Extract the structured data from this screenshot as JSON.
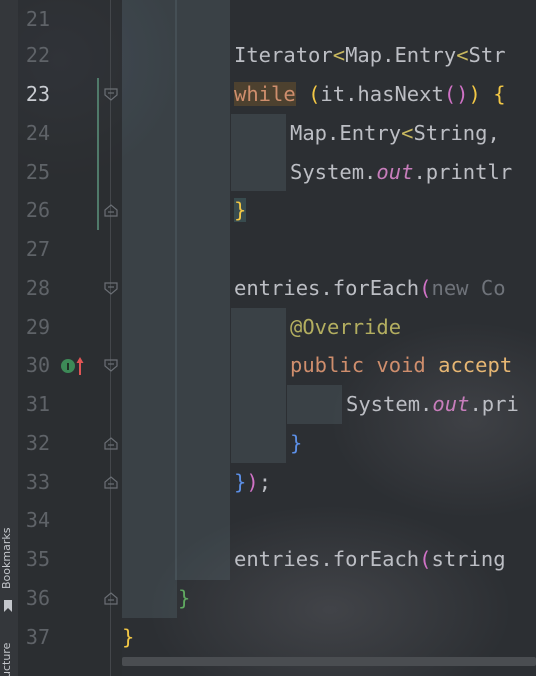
{
  "side_panel": {
    "bookmarks_label": "Bookmarks",
    "structure_label": "ucture"
  },
  "gutter": {
    "line_numbers": [
      "21",
      "22",
      "23",
      "24",
      "25",
      "26",
      "27",
      "28",
      "29",
      "30",
      "31",
      "32",
      "33",
      "34",
      "35",
      "36",
      "37"
    ],
    "current_line": "23"
  },
  "code": {
    "line22": {
      "t1": "Iterator",
      "t2": "<",
      "t3": "Map.Entry",
      "t4": "<",
      "t5": "Str"
    },
    "line23": {
      "t1": "while",
      "t2": " ",
      "t3": "(",
      "t4": "it.hasNext",
      "t5": "()",
      "t6": ")",
      "t7": " ",
      "t8": "{"
    },
    "line24": {
      "t1": "Map.Entry",
      "t2": "<",
      "t3": "String, "
    },
    "line25": {
      "t1": "System.",
      "t2": "out",
      "t3": ".printlr"
    },
    "line26": {
      "t1": "}"
    },
    "line28": {
      "t1": "entries.forEach",
      "t2": "(",
      "t3": "new Co"
    },
    "line29": {
      "t1": "@Override"
    },
    "line30": {
      "t1": "public",
      "t2": " ",
      "t3": "void",
      "t4": " ",
      "t5": "accept"
    },
    "line31": {
      "t1": "System.",
      "t2": "out",
      "t3": ".pri"
    },
    "line32": {
      "t1": "}"
    },
    "line33": {
      "t1": "}",
      "t2": ")",
      "t3": ";"
    },
    "line35": {
      "t1": "entries.forEach",
      "t2": "(",
      "t3": "string"
    },
    "line36": {
      "t1": "}"
    },
    "line37": {
      "t1": "}"
    }
  },
  "icons": {
    "implements": "implemented-method-icon",
    "arrow": "navigate-up-icon",
    "fold": "fold-marker-icon",
    "bookmark": "bookmark-icon"
  },
  "colors": {
    "background": "#2c2f33",
    "keyword": "#cf8e6d",
    "annotation": "#b3ae60",
    "static_field": "#c77dbb",
    "method_declaration": "#e6b673",
    "bracket_yellow": "#f2c745",
    "bracket_magenta": "#d072c6",
    "bracket_blue": "#5c8fe6",
    "line_number": "#5f6368"
  }
}
